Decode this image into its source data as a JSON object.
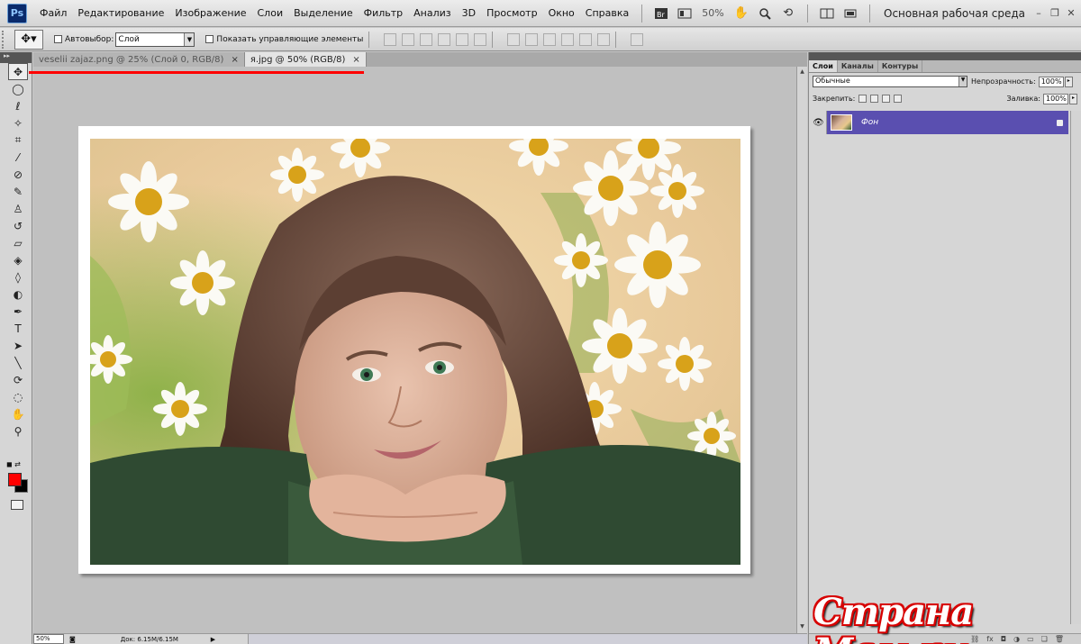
{
  "app": {
    "logo": "Ps"
  },
  "menu": [
    "Файл",
    "Редактирование",
    "Изображение",
    "Слои",
    "Выделение",
    "Фильтр",
    "Анализ",
    "3D",
    "Просмотр",
    "Окно",
    "Справка"
  ],
  "menubar": {
    "zoom": "50%",
    "workspace": "Основная рабочая среда"
  },
  "options": {
    "autoselect_label": "Автовыбор:",
    "autoselect_value": "Слой",
    "show_controls_label": "Показать управляющие элементы"
  },
  "tabs": [
    {
      "label": "veselii zajaz.png @ 25% (Слой 0, RGB/8)",
      "close": "×"
    },
    {
      "label": "я.jpg @ 50% (RGB/8)",
      "close": "×"
    }
  ],
  "status": {
    "zoom": "50%",
    "doc": "Док: 6.15M/6.15M"
  },
  "panel": {
    "tabs": [
      "Слои",
      "Каналы",
      "Контуры"
    ],
    "blend_mode": "Обычные",
    "opacity_label": "Непрозрачность:",
    "opacity_value": "100%",
    "lock_label": "Закрепить:",
    "fill_label": "Заливка:",
    "fill_value": "100%",
    "layers": [
      {
        "name": "Фон"
      }
    ]
  },
  "watermark": "Страна Мам.ру",
  "colors": {
    "foreground": "#ff0000",
    "background": "#000000",
    "selected_layer": "#5a4fb0",
    "annotation": "#ff0000"
  }
}
